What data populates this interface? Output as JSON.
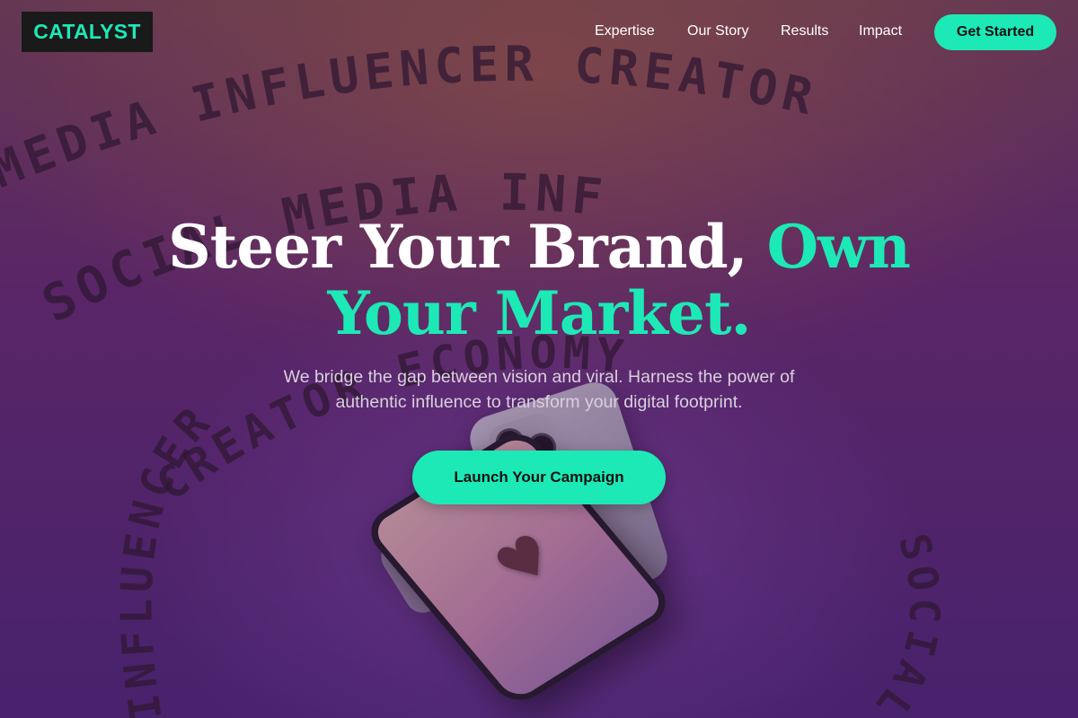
{
  "brand": {
    "logo_text": "CATALYST"
  },
  "nav": {
    "links": [
      "Expertise",
      "Our Story",
      "Results",
      "Impact"
    ],
    "cta_label": "Get Started"
  },
  "hero": {
    "title_line1_white": "Steer Your Brand,",
    "title_line1_accent": "Own",
    "title_line2_accent": "Your Market.",
    "subtitle_line1": "We bridge the gap between vision and viral. Harness the power of",
    "subtitle_line2": "authentic influence to transform your digital footprint.",
    "cta_label": "Launch Your Campaign"
  },
  "background": {
    "ring_words": [
      "MEDIA INFLUENCER CREATOR",
      "SOCIAL MEDIA INF",
      "CREATOR ECONOMY",
      "INFLUENCER",
      "SOCIAL"
    ]
  },
  "colors": {
    "accent": "#1de9b6",
    "logo_bg": "#1a1a1a",
    "text_primary": "#ffffff",
    "text_secondary": "#d8d0dc"
  },
  "icons": {
    "phone_screen_icon": "heart-icon"
  }
}
